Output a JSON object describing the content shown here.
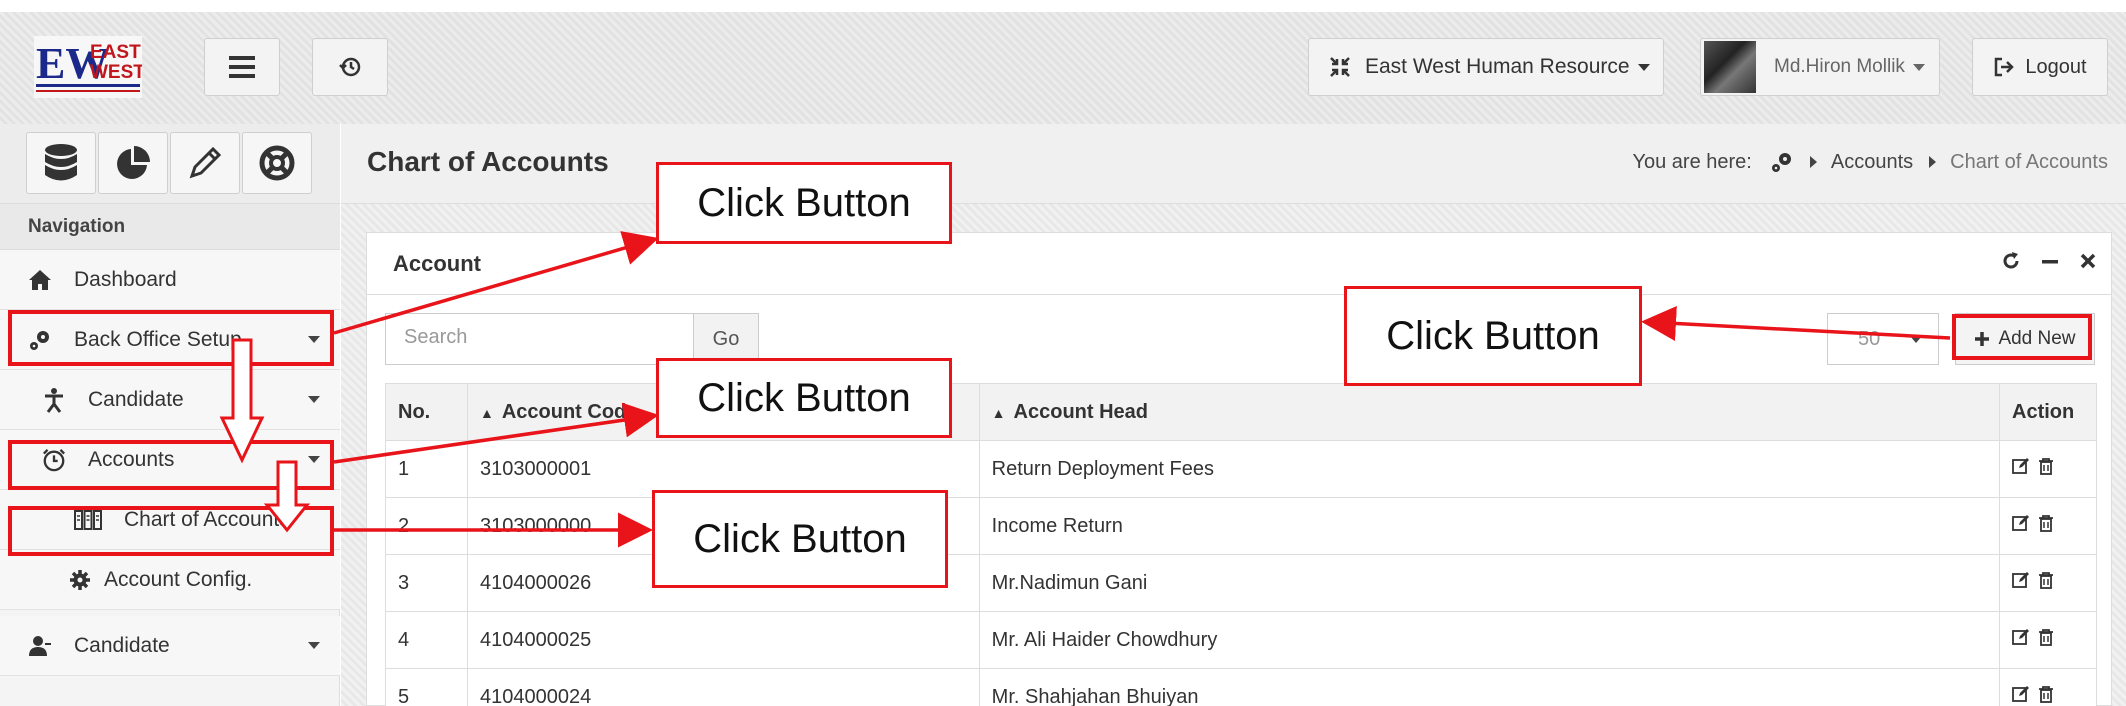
{
  "header": {
    "logo_text": "EW EAST WEST",
    "org_label": "East West Human Resource",
    "user_name": "Md.Hiron Mollik",
    "logout_label": "Logout"
  },
  "sidebar": {
    "nav_title": "Navigation",
    "items": [
      {
        "label": "Dashboard",
        "icon": "home-icon"
      },
      {
        "label": "Back Office Setup",
        "icon": "gears-icon"
      },
      {
        "label": "Candidate",
        "icon": "person-icon"
      },
      {
        "label": "Accounts",
        "icon": "alarm-clock-icon"
      },
      {
        "label": "Chart of Accounts",
        "icon": "columns-icon"
      },
      {
        "label": "Account Config.",
        "icon": "gear-icon"
      },
      {
        "label": "Candidate",
        "icon": "user-icon"
      }
    ]
  },
  "page": {
    "title": "Chart of Accounts",
    "breadcrumb_prefix": "You are here:",
    "breadcrumb": [
      "Accounts",
      "Chart of Accounts"
    ]
  },
  "panel": {
    "title": "Account",
    "search_placeholder": "Search",
    "go_label": "Go",
    "page_size": "50",
    "add_new_label": "Add New",
    "columns": [
      "No.",
      "Account Code",
      "Account Head",
      "Action"
    ],
    "rows": [
      {
        "no": "1",
        "code": "3103000001",
        "head": "Return Deployment Fees"
      },
      {
        "no": "2",
        "code": "3103000000",
        "head": "Income Return"
      },
      {
        "no": "3",
        "code": "4104000026",
        "head": "Mr.Nadimun Gani"
      },
      {
        "no": "4",
        "code": "4104000025",
        "head": "Mr. Ali Haider Chowdhury"
      },
      {
        "no": "5",
        "code": "4104000024",
        "head": "Mr. Shahjahan Bhuiyan"
      }
    ]
  },
  "annotations": {
    "callout_1": "Click Button",
    "callout_2": "Click Button",
    "callout_3": "Click Button",
    "callout_4": "Click Button",
    "color": "#e8141a"
  }
}
